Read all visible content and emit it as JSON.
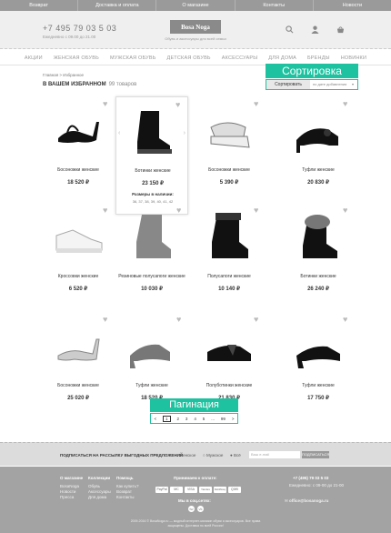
{
  "topnav": [
    "Возврат",
    "Доставка и оплата",
    "О магазине",
    "Контакты",
    "Новости"
  ],
  "header": {
    "phone": "+7 495 79 03 5 03",
    "phone_hours": "Ежедневно с 09.00 до 21.00",
    "logo": "Bosa Noga",
    "logo_tagline": "Обувь и аксессуары для всей семьи"
  },
  "nav": [
    "АКЦИИ",
    "ЖЕНСКАЯ ОБУВЬ",
    "МУЖСКАЯ ОБУВЬ",
    "ДЕТСКАЯ ОБУВЬ",
    "АКСЕССУАРЫ",
    "ДЛЯ ДОМА",
    "БРЕНДЫ",
    "НОВИНКИ"
  ],
  "breadcrumb": "Главная  >  Избранное",
  "page": {
    "title": "В ВАШЕМ ИЗБРАННОМ",
    "count": "99 товаров"
  },
  "sort": {
    "tag": "Сортировка",
    "button": "Сортировать",
    "selected": "по дате добавления"
  },
  "products": [
    {
      "name": "Босоножки женские",
      "price": "18 520 ₽",
      "icon": "sandal-heel"
    },
    {
      "name": "Ботинки женские",
      "price": "23 150 ₽",
      "icon": "ankle-boot",
      "sizes_title": "Размеры в наличии:",
      "sizes": "36, 37, 38, 39, 40, 41, 42"
    },
    {
      "name": "Босоножки женские",
      "price": "5 390 ₽",
      "icon": "platform-sandal"
    },
    {
      "name": "Туфли женские",
      "price": "20 830 ₽",
      "icon": "pump-bow"
    },
    {
      "name": "Кроссовки женские",
      "price": "6 520 ₽",
      "icon": "sneaker"
    },
    {
      "name": "Резиновые полусапоги женские",
      "price": "10 030 ₽",
      "icon": "rubber-boot"
    },
    {
      "name": "Полусапоги женские",
      "price": "10 140 ₽",
      "icon": "fur-boot"
    },
    {
      "name": "Ботинки женские",
      "price": "26 240 ₽",
      "icon": "fur-ankle-boot"
    },
    {
      "name": "Босоножки женские",
      "price": "25 020 ₽",
      "icon": "jeweled-sandal"
    },
    {
      "name": "Туфли женские",
      "price": "18 520 ₽",
      "icon": "block-heel"
    },
    {
      "name": "Полуботинки женские",
      "price": "21 830 ₽",
      "icon": "loafer"
    },
    {
      "name": "Туфли женские",
      "price": "17 750 ₽",
      "icon": "patent-pump"
    }
  ],
  "pagination": {
    "tag": "Пагинация",
    "pages": [
      "<",
      "1",
      "2",
      "3",
      "4",
      "5",
      "...",
      "99",
      ">"
    ],
    "current": "1"
  },
  "subscribe": {
    "text": "ПОДПИСАТЬСЯ НА РАССЫЛКУ ВЫГОДНЫХ ПРЕДЛОЖЕНИЙ",
    "options": [
      "Женское",
      "Мужское",
      "Всё"
    ],
    "placeholder": "Ваш e-mail",
    "button": "ПОДПИСАТЬСЯ"
  },
  "footer": {
    "col1_title": "О магазине",
    "col1": [
      "BosaNoga",
      "Новости",
      "Пресса"
    ],
    "col2_title": "Коллекции",
    "col2": [
      "Обувь",
      "Аксессуары",
      "Для дома"
    ],
    "col3_title": "Помощь",
    "col3": [
      "Как купить?",
      "Возврат",
      "Контакты"
    ],
    "pay_title": "Принимаем к оплате:",
    "pay": [
      "PayPal",
      "MC",
      "VISA",
      "Yandex",
      "WebMoney",
      "QIWI"
    ],
    "social_title": "Мы в соц.сетях:",
    "social": [
      "tw",
      "vk"
    ],
    "phone": "+7 (495) 79 03 5 03",
    "phone_hours": "Ежедневно: с 09-00 до 21-00",
    "email": "office@bosanoga.ru",
    "copyright": "2009-2016 © BosaNoga.ru — модный интернет-магазин обуви и аксессуаров. Все права защищены. Доставка по всей России!"
  }
}
